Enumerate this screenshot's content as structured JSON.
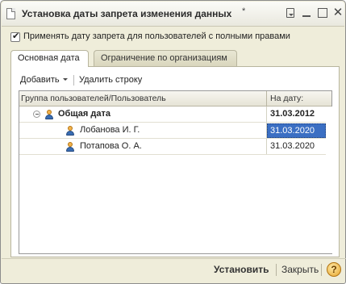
{
  "window": {
    "title": "Установка даты запрета изменения данных",
    "modified_marker": "*"
  },
  "options": {
    "apply_full_rights_label": "Применять дату запрета для пользователей с полными правами",
    "apply_full_rights_checked": true
  },
  "tabs": [
    {
      "label": "Основная дата",
      "active": true
    },
    {
      "label": "Ограничение по организациям",
      "active": false
    }
  ],
  "toolbar": {
    "add_label": "Добавить",
    "delete_row_label": "Удалить строку"
  },
  "table": {
    "columns": [
      "Группа пользователей/Пользователь",
      "На дату:"
    ],
    "rows": [
      {
        "name": "Общая дата",
        "date": "31.03.2012",
        "level": 0,
        "bold": true,
        "expandable": true,
        "selected": false
      },
      {
        "name": "Лобанова И. Г.",
        "date": "31.03.2020",
        "level": 1,
        "bold": false,
        "expandable": false,
        "selected": true
      },
      {
        "name": "Потапова О. А.",
        "date": "31.03.2020",
        "level": 1,
        "bold": false,
        "expandable": false,
        "selected": false
      }
    ]
  },
  "footer": {
    "set_label": "Установить",
    "close_label": "Закрыть",
    "help_label": "?"
  },
  "icons": {
    "window": "document-icon",
    "tree_collapse": "collapse-icon",
    "user": "user-icon",
    "help": "help-icon"
  },
  "colors": {
    "window_bg": "#efedda",
    "selection": "#3b6fc3",
    "tab_inactive": "#d9d6bd"
  }
}
